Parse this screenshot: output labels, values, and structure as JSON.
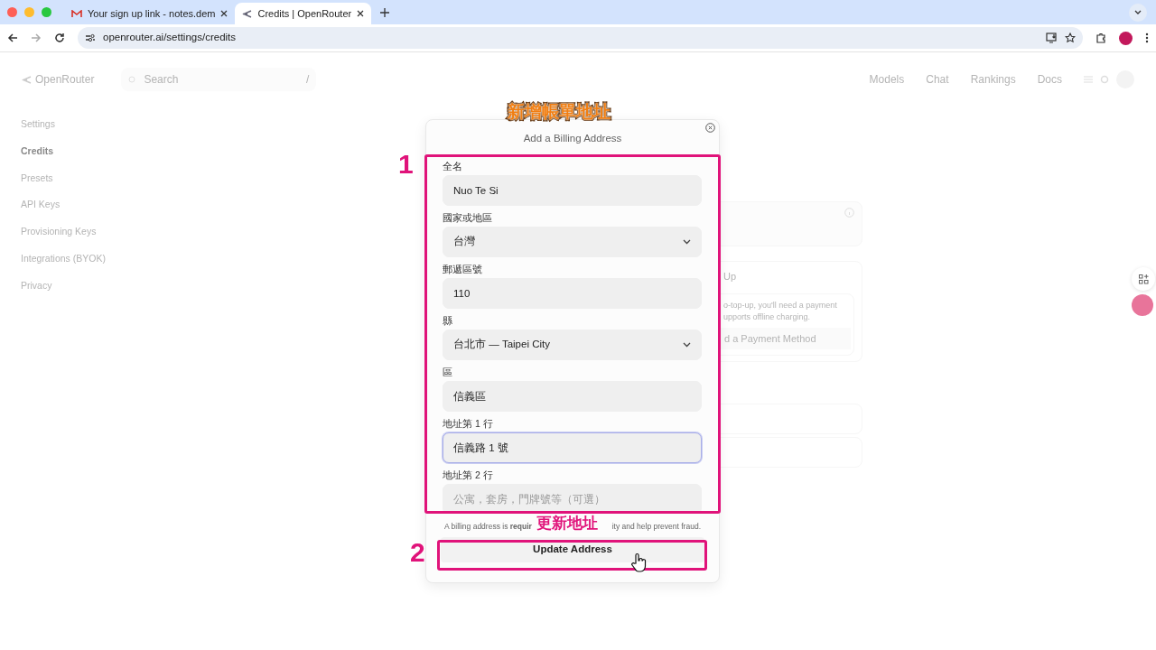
{
  "browser": {
    "tabs": [
      {
        "title": "Your sign up link - notes.dem",
        "selected": false
      },
      {
        "title": "Credits | OpenRouter",
        "selected": true
      }
    ],
    "url": "openrouter.ai/settings/credits"
  },
  "header": {
    "logo": "OpenRouter",
    "search": {
      "placeholder": "Search",
      "shortcut": "/"
    },
    "nav": [
      "Models",
      "Chat",
      "Rankings",
      "Docs"
    ]
  },
  "sidebar": {
    "items": [
      {
        "label": "Settings",
        "selected": false
      },
      {
        "label": "Credits",
        "selected": true
      },
      {
        "label": "Presets",
        "selected": false
      },
      {
        "label": "API Keys",
        "selected": false
      },
      {
        "label": "Provisioning Keys",
        "selected": false
      },
      {
        "label": "Integrations (BYOK)",
        "selected": false
      },
      {
        "label": "Privacy",
        "selected": false
      }
    ]
  },
  "background_content": {
    "card_heading": "Up",
    "card_text": [
      "o-top-up, you'll need a payment",
      "upports offline charging."
    ],
    "card_button": "d a Payment Method"
  },
  "modal": {
    "title": "Add a Billing Address",
    "fields": [
      {
        "label": "全名",
        "kind": "text",
        "value": "Nuo Te Si",
        "focused": false
      },
      {
        "label": "國家或地區",
        "kind": "select",
        "value": "台灣",
        "focused": false
      },
      {
        "label": "郵遞區號",
        "kind": "text",
        "value": "110",
        "focused": false
      },
      {
        "label": "縣",
        "kind": "select",
        "value": "台北市 — Taipei City",
        "focused": false
      },
      {
        "label": "區",
        "kind": "text",
        "value": "信義區",
        "focused": false
      },
      {
        "label": "地址第 1 行",
        "kind": "text",
        "value": "信義路 1 號",
        "focused": true
      },
      {
        "label": "地址第 2 行",
        "kind": "text",
        "placeholder": "公寓，套房，門牌號等（可選）",
        "focused": false
      }
    ],
    "note_start": "A billing address is **requir**",
    "note_end": "ity and help prevent fraud.",
    "button": "Update Address"
  },
  "annotations": {
    "title": "新增帳單地址",
    "steps": [
      "1",
      "2"
    ],
    "button_label": "更新地址"
  }
}
